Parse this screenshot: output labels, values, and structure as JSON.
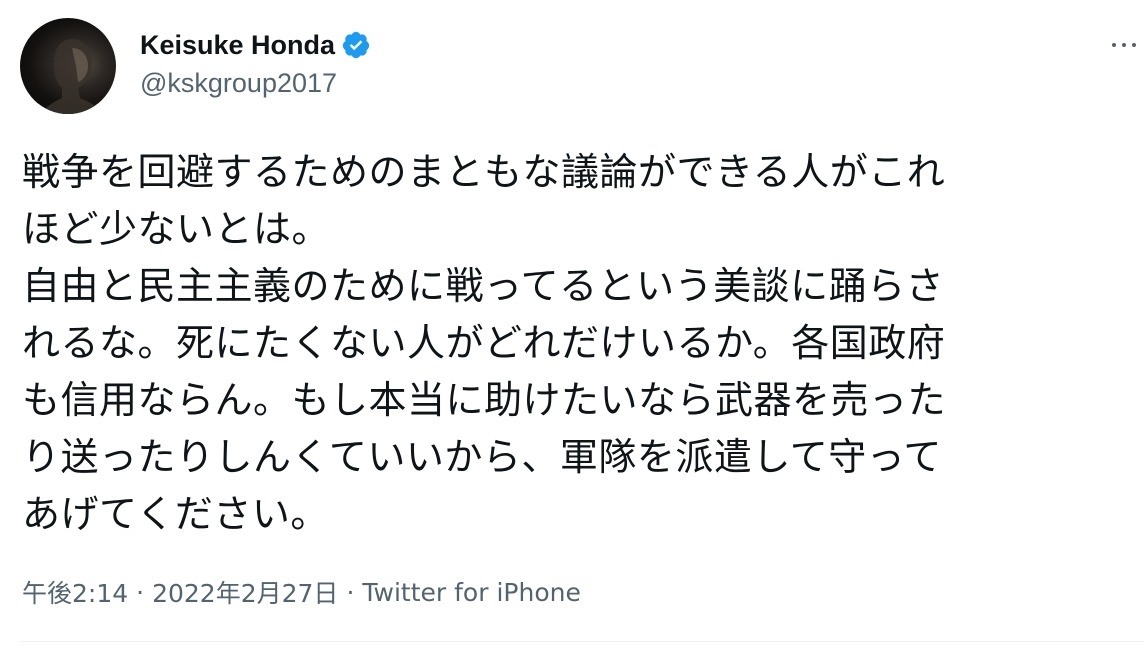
{
  "author": {
    "display_name": "Keisuke Honda",
    "handle": "@kskgroup2017",
    "verified": true,
    "verified_icon": "verified-badge-icon",
    "verified_color": "#1d9bf0"
  },
  "tweet": {
    "lines": [
      "戦争を回避するためのまともな議論ができる人がこれ",
      "ほど少ないとは。",
      "自由と民主主義のために戦ってるという美談に踊らさ",
      "れるな。死にたくない人がどれだけいるか。各国政府",
      "も信用ならん。もし本当に助けたいなら武器を売った",
      "り送ったりしんくていいから、軍隊を派遣して守って",
      "あげてください。"
    ]
  },
  "meta": {
    "time": "午後2:14",
    "separator": "·",
    "date": "2022年2月27日",
    "source": "Twitter for iPhone"
  },
  "icons": {
    "more": "more-horizontal-icon"
  },
  "colors": {
    "text": "#0f1419",
    "secondary": "#536471",
    "divider": "#eff3f4"
  }
}
